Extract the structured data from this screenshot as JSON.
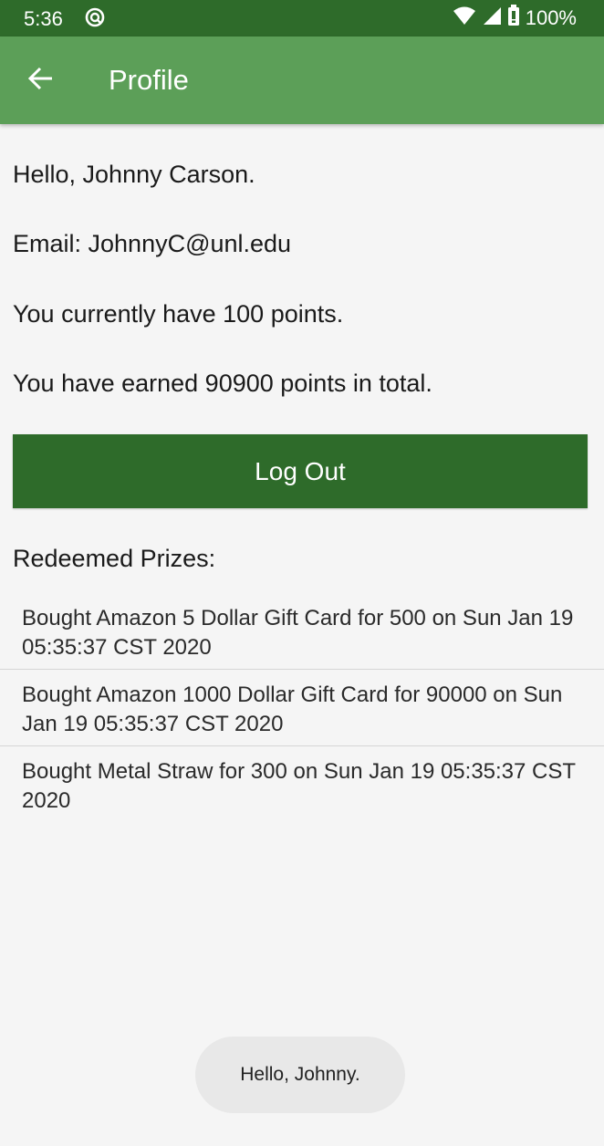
{
  "status_bar": {
    "time": "5:36",
    "battery": "100%",
    "icons": [
      "sync-icon",
      "wifi-icon",
      "signal-icon",
      "battery-icon"
    ]
  },
  "app_bar": {
    "title": "Profile",
    "back_icon": "arrow-back-icon"
  },
  "profile": {
    "greeting": "Hello, Johnny Carson.",
    "email": "Email: JohnnyC@unl.edu",
    "current_points": "You currently have 100 points.",
    "total_points": "You have earned 90900 points in total."
  },
  "logout": {
    "label": "Log Out"
  },
  "redeemed": {
    "heading": "Redeemed Prizes:",
    "items": [
      "Bought Amazon 5 Dollar Gift Card for 500 on Sun Jan 19 05:35:37 CST 2020",
      "Bought Amazon 1000 Dollar Gift Card for 90000 on Sun Jan 19 05:35:37 CST 2020",
      "Bought Metal Straw for 300 on Sun Jan 19 05:35:37 CST 2020"
    ]
  },
  "toast": {
    "message": "Hello, Johnny."
  },
  "colors": {
    "status_bar": "#2e6b2a",
    "app_bar": "#5c9f58",
    "button": "#2e6b2a",
    "background": "#f5f5f5"
  }
}
